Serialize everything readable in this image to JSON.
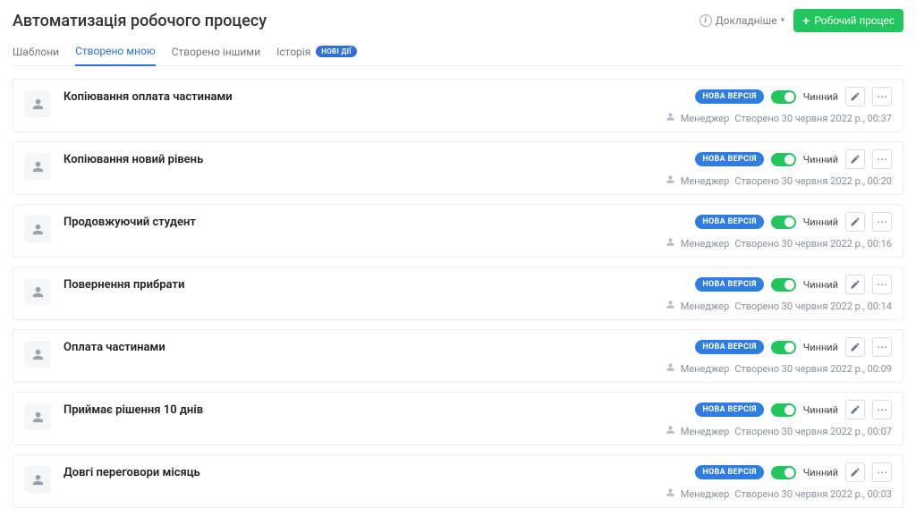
{
  "header": {
    "title": "Автоматизація робочого процесу",
    "more_label": "Докладніше",
    "create_label": "Робочий процес"
  },
  "tabs": [
    {
      "label": "Шаблони",
      "active": false
    },
    {
      "label": "Створено мною",
      "active": true
    },
    {
      "label": "Створено іншими",
      "active": false
    },
    {
      "label": "Історія",
      "active": false,
      "badge": "НОВІ ДІЇ"
    }
  ],
  "row_common": {
    "badge": "НОВА ВЕРСІЯ",
    "status": "Чинний",
    "role": "Менеджер",
    "created_prefix": "Створено"
  },
  "rows": [
    {
      "title": "Копіювання оплата частинами",
      "created": "30 червня 2022 р., 00:37"
    },
    {
      "title": "Копіювання новий рівень",
      "created": "30 червня 2022 р., 00:20"
    },
    {
      "title": "Продовжуючий студент",
      "created": "30 червня 2022 р., 00:16"
    },
    {
      "title": "Повернення прибрати",
      "created": "30 червня 2022 р., 00:14"
    },
    {
      "title": "Оплата частинами",
      "created": "30 червня 2022 р., 00:09"
    },
    {
      "title": "Приймає рішення 10 днів",
      "created": "30 червня 2022 р., 00:07"
    },
    {
      "title": "Довгі переговори місяць",
      "created": "30 червня 2022 р., 00:03"
    }
  ]
}
